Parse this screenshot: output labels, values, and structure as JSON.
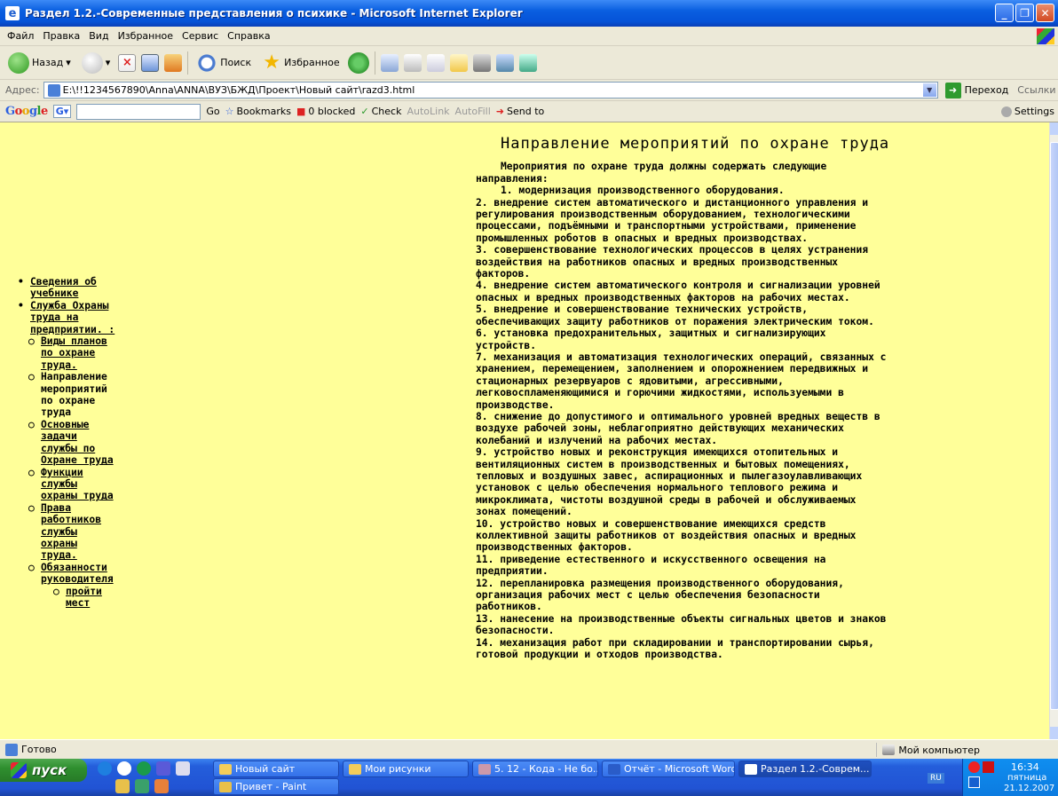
{
  "window": {
    "title": "Раздел 1.2.-Современные представления о психике - Microsoft Internet Explorer"
  },
  "menu": [
    "Файл",
    "Правка",
    "Вид",
    "Избранное",
    "Сервис",
    "Справка"
  ],
  "toolbar": {
    "back": "Назад",
    "search": "Поиск",
    "favorites": "Избранное"
  },
  "address": {
    "label": "Адрес:",
    "url": "E:\\!!1234567890\\Anna\\ANNA\\ВУЗ\\БЖД\\Проект\\Новый сайт\\razd3.html",
    "go": "Переход",
    "links": "Ссылки"
  },
  "google": {
    "logo": "Google",
    "go": "Go",
    "bookmarks": "Bookmarks",
    "blocked": "0 blocked",
    "check": "Check",
    "autolink": "AutoLink",
    "autofill": "AutoFill",
    "sendto": "Send to",
    "settings": "Settings"
  },
  "nav": {
    "item1": [
      "Сведения об",
      "учебнике"
    ],
    "item2": [
      "Служба Охраны",
      "труда на",
      "предприятии. :"
    ],
    "sub1": [
      "Виды планов",
      "по охране",
      "труда."
    ],
    "sub2": [
      "Направление",
      "мероприятий",
      "по охране",
      "труда"
    ],
    "sub3": [
      "Основные",
      "задачи",
      "службы по",
      "Охране труда"
    ],
    "sub4": [
      "Функции",
      "службы",
      "охраны труда"
    ],
    "sub5": [
      "Права",
      "работников",
      "службы",
      "охраны",
      "труда."
    ],
    "sub6": [
      "Обязанности",
      "руководителя"
    ],
    "subsub": [
      "пройти",
      "мест"
    ]
  },
  "main": {
    "heading": "Направление мероприятий по охране труда",
    "lines": [
      "Мероприятия по охране труда должны содержать следующие",
      "направления:",
      "1. модернизация производственного оборудования.",
      "2. внедрение систем автоматического и дистанционного управления и",
      "регулирования производственным оборудованием, технологическими",
      "процессами, подъёмными и транспортными устройствами, применение",
      "промышленных роботов в опасных и вредных производствах.",
      "3. совершенствование технологических процессов в целях устранения",
      "воздействия на работников опасных и вредных производственных",
      "факторов.",
      "4. внедрение систем автоматического контроля и сигнализации уровней",
      "опасных и вредных производственных факторов на рабочих местах.",
      "5. внедрение и совершенствование технических устройств,",
      "обеспечивающих защиту работников от поражения электрическим током.",
      "6. установка предохранительных, защитных и сигнализирующих",
      "устройств.",
      "7. механизация и автоматизация технологических операций, связанных с",
      "хранением, перемещением, заполнением и опорожнением передвижных и",
      "стационарных резервуаров с ядовитыми, агрессивными,",
      "легковоспламеняющимися и горючими жидкостями, используемыми в",
      "производстве.",
      "8. снижение до допустимого и оптимального уровней вредных веществ в",
      "воздухе рабочей зоны, неблагоприятно действующих механических",
      "колебаний и излучений на рабочих местах.",
      "9. устройство новых и реконструкция имеющихся отопительных и",
      "вентиляционных систем в производственных и бытовых помещениях,",
      "тепловых и воздушных завес, аспирационных и пылегазоулавливающих",
      "установок с целью обеспечения нормального теплового режима и",
      "микроклимата, чистоты воздушной среды в рабочей и обслуживаемых",
      "зонах помещений.",
      "10. устройство новых и совершенствование имеющихся средств",
      "коллективной защиты работников от воздействия опасных и вредных",
      "производственных факторов.",
      "11. приведение естественного и искусственного освещения на",
      "предприятии.",
      "12. перепланировка размещения производственного оборудования,",
      "организация рабочих мест с целью обеспечения безопасности",
      "работников.",
      "13. нанесение на производственные объекты сигнальных цветов и знаков",
      "безопасности.",
      "14. механизация работ при складировании и транспортировании сырья,",
      "готовой продукции и отходов производства."
    ]
  },
  "status": {
    "left": "Готово",
    "zone": "Мой компьютер"
  },
  "taskbar": {
    "start": "пуск",
    "tasks": [
      "Новый сайт",
      "Мои рисунки",
      "5. 12 - Кода - Не бо...",
      "Отчёт - Microsoft Word",
      "Раздел 1.2.-Соврем...",
      "Привет - Paint"
    ],
    "lang": "RU",
    "time": "16:34",
    "day": "пятница",
    "date": "21.12.2007"
  },
  "colors": {
    "page_bg": "#ffff99",
    "titlebar": "#0a5fe0",
    "taskbar": "#245edb",
    "start": "#2f8f2f"
  }
}
